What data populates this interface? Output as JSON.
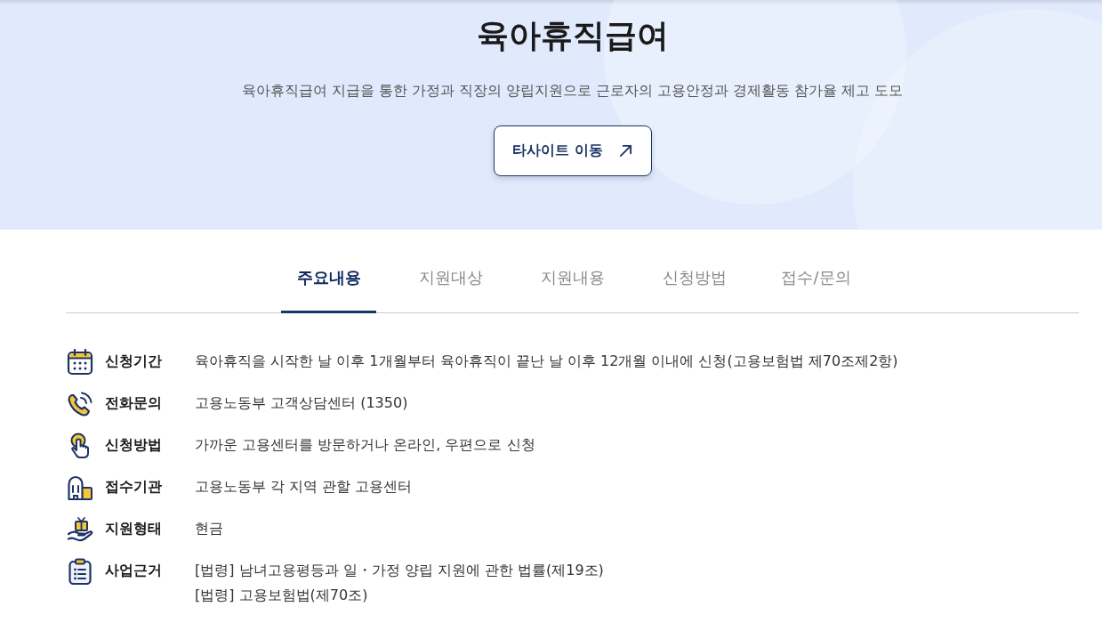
{
  "hero": {
    "title": "육아휴직급여",
    "description": "육아휴직급여 지급을 통한 가정과 직장의 양립지원으로 근로자의 고용안정과 경제활동 참가율 제고 도모",
    "button": {
      "label": "타사이트 이동"
    }
  },
  "tabs": [
    {
      "label": "주요내용",
      "selected": true
    },
    {
      "label": "지원대상",
      "selected": false
    },
    {
      "label": "지원내용",
      "selected": false
    },
    {
      "label": "신청방법",
      "selected": false
    },
    {
      "label": "접수/문의",
      "selected": false
    }
  ],
  "details": [
    {
      "label": "신청기간",
      "values": [
        "육아휴직을 시작한 날 이후 1개월부터 육아휴직이 끝난 날 이후 12개월 이내에 신청(고용보험법 제70조제2항)"
      ]
    },
    {
      "label": "전화문의",
      "values": [
        "고용노동부 고객상담센터 (1350)"
      ]
    },
    {
      "label": "신청방법",
      "values": [
        "가까운 고용센터를 방문하거나 온라인, 우편으로 신청"
      ]
    },
    {
      "label": "접수기관",
      "values": [
        "고용노동부 각 지역 관할 고용센터"
      ]
    },
    {
      "label": "지원형태",
      "values": [
        "현금"
      ]
    },
    {
      "label": "사업근거",
      "values": [
        "[법령] 남녀고용평등과 일・가정 양립 지원에 관한 법률(제19조)",
        "[법령] 고용보험법(제70조)"
      ]
    }
  ]
}
